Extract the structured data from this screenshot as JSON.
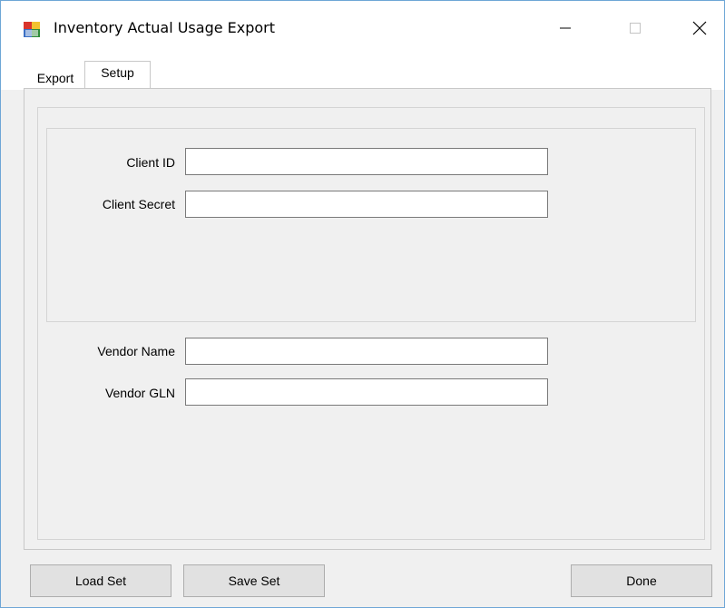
{
  "window": {
    "title": "Inventory Actual Usage Export",
    "controls": [
      "minimize-icon",
      "maximize-icon",
      "close-icon"
    ]
  },
  "tabs": [
    {
      "label": "Export",
      "active": false
    },
    {
      "label": "Setup",
      "active": true
    }
  ],
  "setup": {
    "credentials": [
      {
        "label": "Client ID",
        "value": ""
      },
      {
        "label": "Client Secret",
        "value": ""
      }
    ],
    "vendor": [
      {
        "label": "Vendor Name",
        "value": ""
      },
      {
        "label": "Vendor GLN",
        "value": ""
      }
    ]
  },
  "buttons": {
    "load": "Load Set",
    "save": "Save Set",
    "done": "Done"
  }
}
